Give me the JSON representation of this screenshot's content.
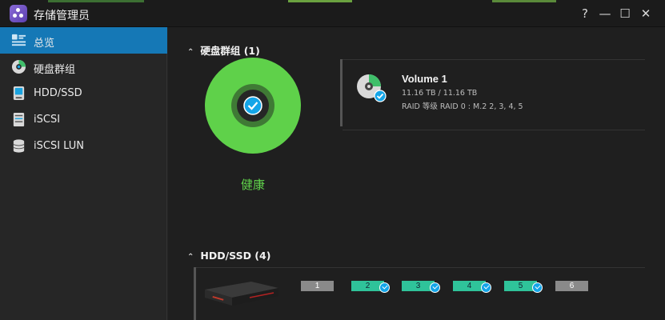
{
  "window": {
    "title": "存储管理员",
    "help": "?",
    "minimize": "—",
    "maximize": "☐",
    "close": "✕"
  },
  "sidebar": {
    "items": [
      {
        "label": "总览",
        "icon": "overview-icon",
        "active": true
      },
      {
        "label": "硬盘群组",
        "icon": "disk-group-icon",
        "active": false
      },
      {
        "label": "HDD/SSD",
        "icon": "hdd-icon",
        "active": false
      },
      {
        "label": "iSCSI",
        "icon": "iscsi-icon",
        "active": false
      },
      {
        "label": "iSCSI LUN",
        "icon": "database-icon",
        "active": false
      }
    ]
  },
  "disk_group": {
    "header": "硬盘群组 (1)",
    "status": "健康",
    "volume": {
      "name": "Volume 1",
      "capacity": "11.16 TB / 11.16 TB",
      "raid": "RAID 等级 RAID 0 : M.2 2, 3, 4, 5"
    }
  },
  "hdd_ssd": {
    "header": "HDD/SSD (4)",
    "slots": [
      {
        "label": "1",
        "installed": false
      },
      {
        "label": "2",
        "installed": true
      },
      {
        "label": "3",
        "installed": true
      },
      {
        "label": "4",
        "installed": true
      },
      {
        "label": "5",
        "installed": true
      },
      {
        "label": "6",
        "installed": false
      }
    ]
  },
  "colors": {
    "accent": "#1578b6",
    "healthy": "#5fd14a",
    "slot_ok": "#2fc39a",
    "check": "#14a5e8"
  }
}
